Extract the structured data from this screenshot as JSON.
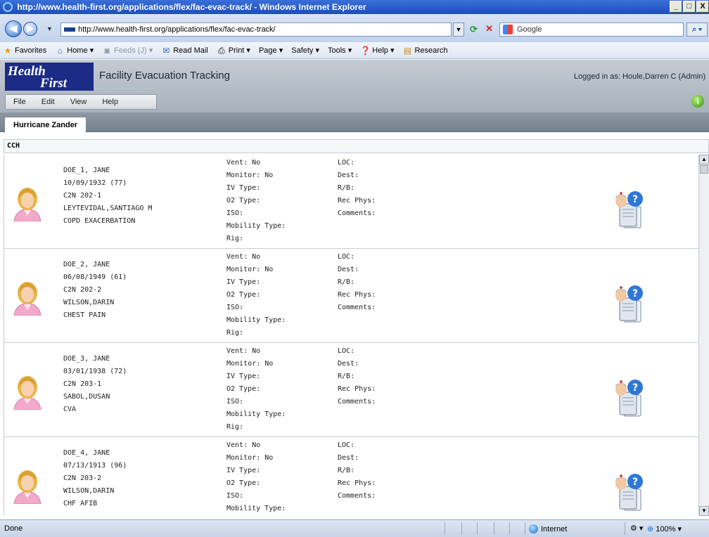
{
  "window": {
    "title": "http://www.health-first.org/applications/flex/fac-evac-track/ - Windows Internet Explorer",
    "minimize": "_",
    "maximize": "□",
    "close": "X"
  },
  "browser": {
    "url": "http://www.health-first.org/applications/flex/fac-evac-track/",
    "search_text": "Google",
    "commands": {
      "favorites": "Favorites",
      "home": "Home",
      "feeds": "Feeds (J)",
      "read_mail": "Read Mail",
      "print": "Print",
      "page": "Page",
      "safety": "Safety",
      "tools": "Tools",
      "help": "Help",
      "research": "Research"
    }
  },
  "app": {
    "logo_line1": "Health",
    "logo_line2": "First",
    "title": "Facility Evacuation Tracking",
    "logged_in": "Logged in as: Houle,Darren C (Admin)",
    "menu": [
      "File",
      "Edit",
      "View",
      "Help"
    ],
    "tab": "Hurricane Zander",
    "facility": "CCH"
  },
  "labels": {
    "vent": "Vent: ",
    "monitor": "Monitor: ",
    "iv_type": "IV Type:",
    "o2_type": "O2 Type:",
    "iso": "ISO:",
    "mobility_type": "Mobility Type:",
    "rig": "Rig:",
    "loc": "LOC:",
    "dest": "Dest:",
    "rb": "R/B:",
    "rec_phys": "Rec Phys:",
    "comments": "Comments:"
  },
  "patients": [
    {
      "name": "DOE_1, JANE",
      "dob": "10/09/1932 (77)",
      "room": "C2N 202-1",
      "physician": "LEYTEVIDAL,SANTIAGO M",
      "diagnosis": "COPD EXACERBATION",
      "vent": "No",
      "monitor": "No"
    },
    {
      "name": "DOE_2, JANE",
      "dob": "06/08/1949 (61)",
      "room": "C2N 202-2",
      "physician": "WILSON,DARIN",
      "diagnosis": "CHEST PAIN",
      "vent": "No",
      "monitor": "No"
    },
    {
      "name": "DOE_3, JANE",
      "dob": "03/01/1938 (72)",
      "room": "C2N 203-1",
      "physician": "SABOL,DUSAN",
      "diagnosis": "CVA",
      "vent": "No",
      "monitor": "No"
    },
    {
      "name": "DOE_4, JANE",
      "dob": "07/13/1913 (96)",
      "room": "C2N 203-2",
      "physician": "WILSON,DARIN",
      "diagnosis": "CHF AFIB",
      "vent": "No",
      "monitor": "No"
    }
  ],
  "status": {
    "text": "Done",
    "zone": "Internet",
    "zoom": "100%"
  },
  "colors": {
    "header_bg": "#b6bec7",
    "logo_bg": "#1b2b86",
    "tabstrip_bg": "#838d99"
  }
}
